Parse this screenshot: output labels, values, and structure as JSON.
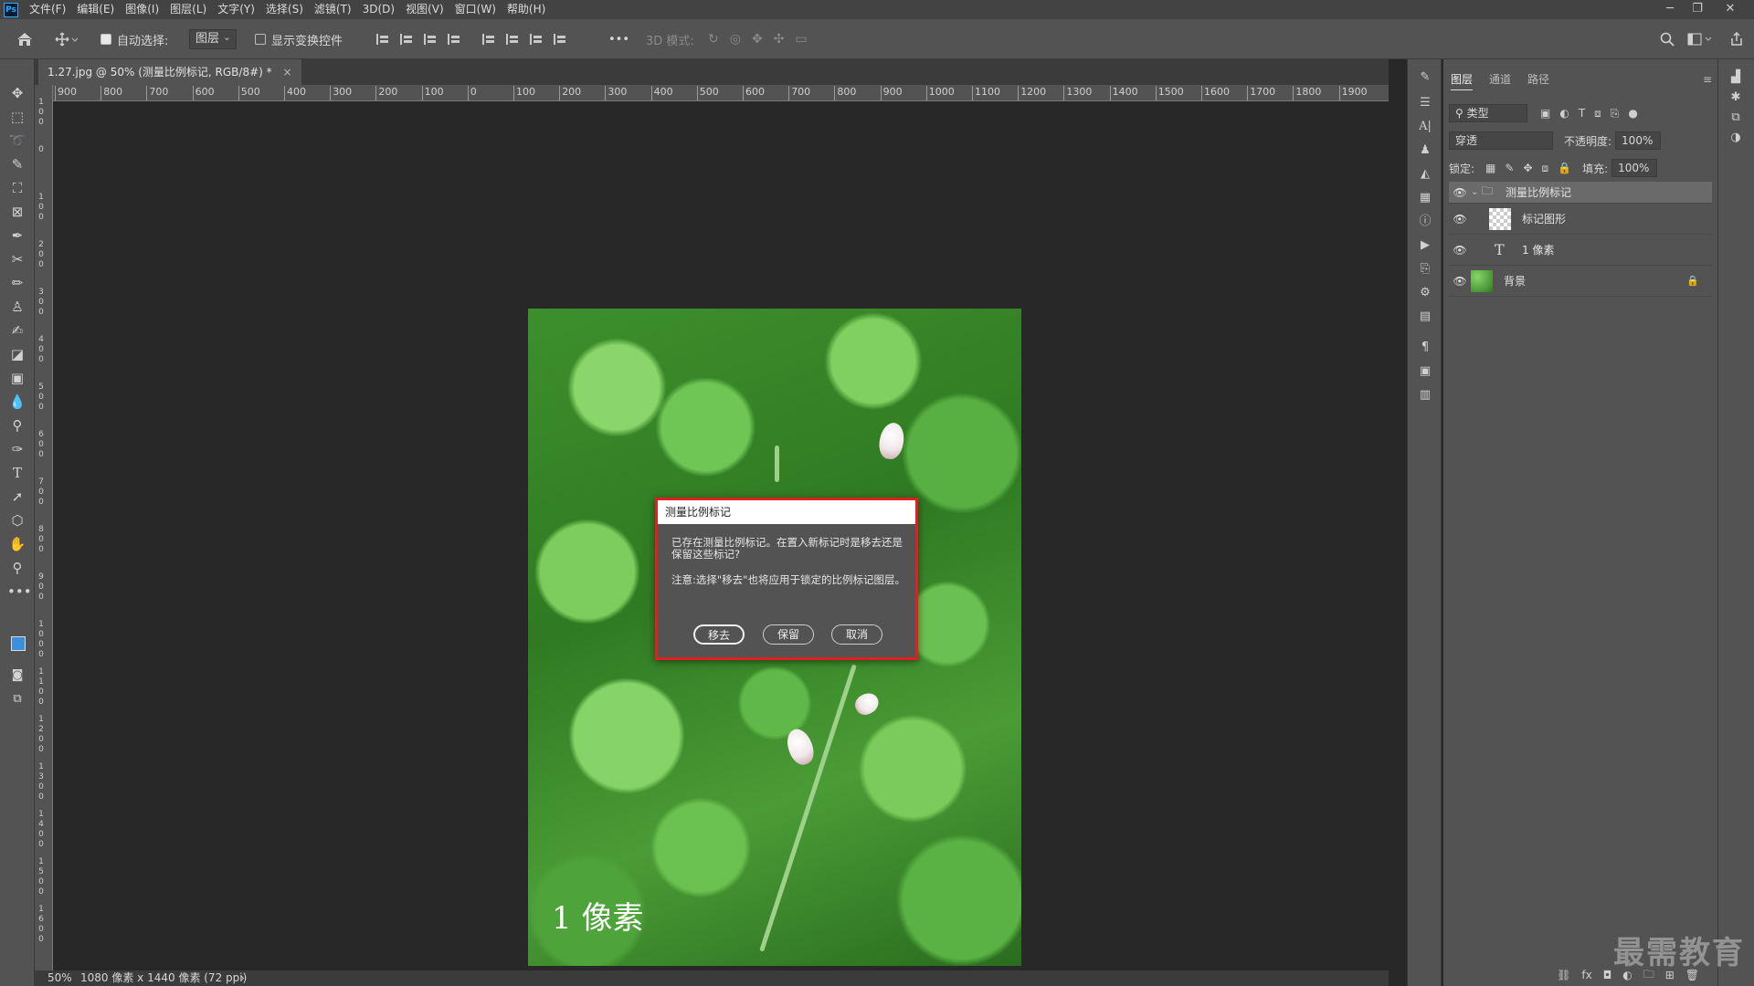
{
  "menubar": {
    "items": [
      "文件(F)",
      "编辑(E)",
      "图像(I)",
      "图层(L)",
      "文字(Y)",
      "选择(S)",
      "滤镜(T)",
      "3D(D)",
      "视图(V)",
      "窗口(W)",
      "帮助(H)"
    ],
    "window_controls": [
      "─",
      "❐",
      "✕"
    ]
  },
  "options": {
    "auto_select_label": "自动选择:",
    "auto_select_value": "图层",
    "show_transform_label": "显示变换控件",
    "more": "•••",
    "mode_3d": "3D 模式:"
  },
  "document": {
    "tab_title": "1.27.jpg @ 50% (测量比例标记, RGB/8#) *",
    "tab_close": "×",
    "image_text": "1 像素"
  },
  "ruler": {
    "top": [
      "900",
      "800",
      "700",
      "600",
      "500",
      "400",
      "300",
      "200",
      "100",
      "0",
      "100",
      "200",
      "300",
      "400",
      "500",
      "600",
      "700",
      "800",
      "900",
      "1000",
      "1100",
      "1200",
      "1300",
      "1400",
      "1500",
      "1600",
      "1700",
      "1800",
      "1900"
    ],
    "left": [
      "1\n0\n0",
      "0",
      "1\n0\n0",
      "2\n0\n0",
      "3\n0\n0",
      "4\n0\n0",
      "5\n0\n0",
      "6\n0\n0",
      "7\n0\n0",
      "8\n0\n0",
      "9\n0\n0",
      "1\n0\n0\n0",
      "1\n1\n0\n0",
      "1\n2\n0\n0",
      "1\n3\n0\n0",
      "1\n4\n0\n0",
      "1\n5\n0\n0",
      "1\n6\n0\n0"
    ]
  },
  "dialog": {
    "title": "测量比例标记",
    "message": "已存在测量比例标记。在置入新标记时是移去还是保留这些标记?",
    "note": "注意:选择\"移去\"也将应用于锁定的比例标记图层。",
    "buttons": {
      "remove": "移去",
      "keep": "保留",
      "cancel": "取消"
    }
  },
  "status": {
    "zoom": "50%",
    "info": "1080 像素 x 1440 像素 (72 ppi)",
    "arrow": "›"
  },
  "panel": {
    "tabs": [
      "图层",
      "通道",
      "路径"
    ],
    "filter_label": "类型",
    "blend_mode": "穿透",
    "opacity_label": "不透明度:",
    "opacity_value": "100%",
    "lock_label": "锁定:",
    "fill_label": "填充:",
    "fill_value": "100%",
    "layers": [
      {
        "name": "测量比例标记",
        "type": "group"
      },
      {
        "name": "标记图形",
        "type": "shape"
      },
      {
        "name": "1 像素",
        "type": "text"
      },
      {
        "name": "背景",
        "type": "image"
      }
    ]
  },
  "watermark": "最需教育",
  "colors": {
    "dialog_border": "#e02020",
    "foreground": "#3b8fdc",
    "background": "#ffffff",
    "selected_layer": "#6a6a6a"
  }
}
